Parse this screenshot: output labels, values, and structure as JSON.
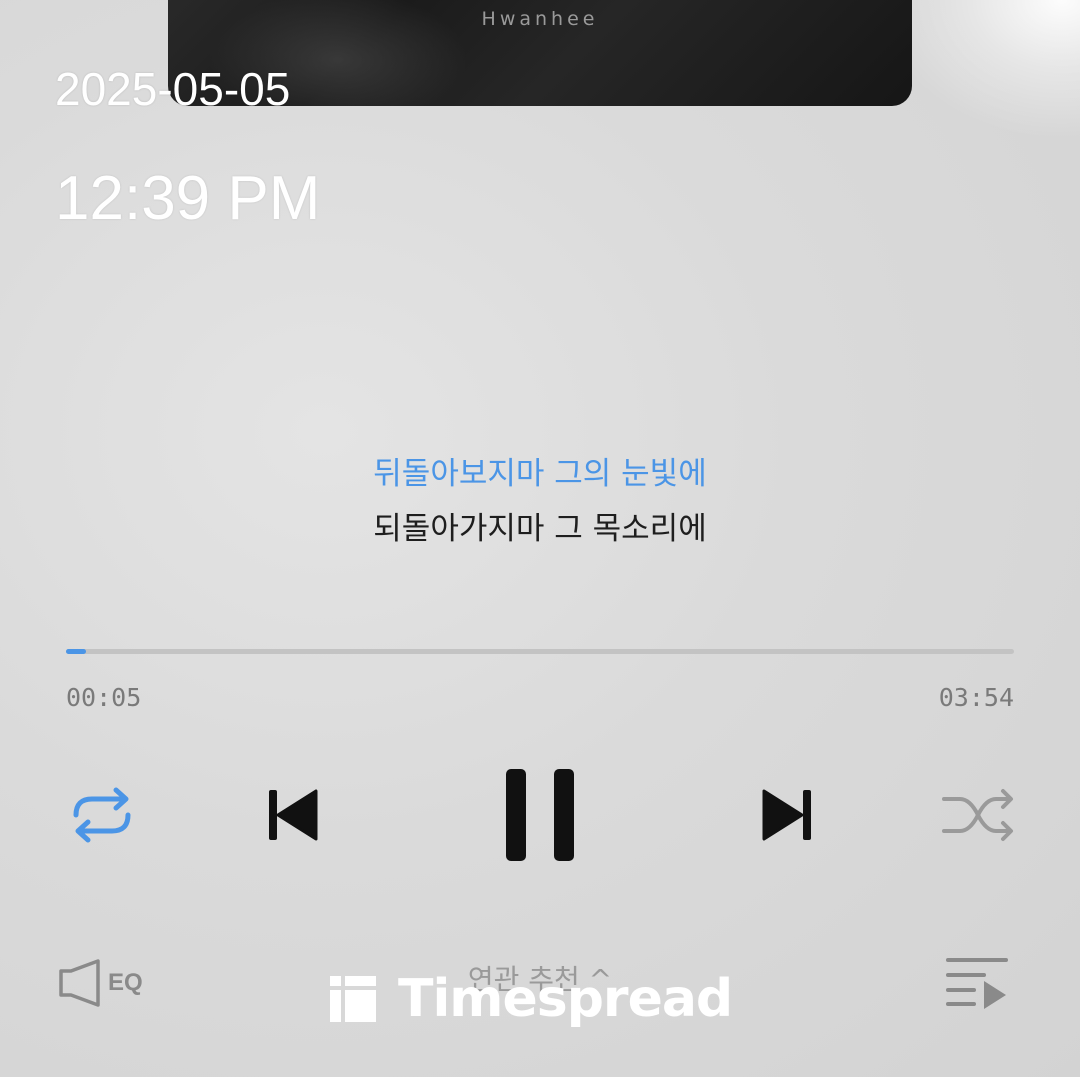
{
  "status": {
    "date": "2025-05-05",
    "time": "12:39 PM"
  },
  "album": {
    "artist": "Hwanhee"
  },
  "lyrics": {
    "current": "뒤돌아보지마 그의 눈빛에",
    "next": "되돌아가지마 그 목소리에"
  },
  "playback": {
    "elapsed": "00:05",
    "duration": "03:54",
    "progress_fraction": 0.021,
    "state": "playing"
  },
  "controls": {
    "repeat": {
      "icon": "repeat-icon",
      "active": true
    },
    "previous": {
      "icon": "skip-previous-icon"
    },
    "pause": {
      "icon": "pause-icon"
    },
    "next": {
      "icon": "skip-next-icon"
    },
    "shuffle": {
      "icon": "shuffle-icon",
      "active": false
    }
  },
  "bottom_bar": {
    "eq_label": "EQ",
    "recommend_label": "연관 추천 ^",
    "playlist_icon": "playlist-icon"
  },
  "watermark": {
    "text": "Timespread"
  },
  "colors": {
    "accent": "#4b95e6",
    "background": "#d8d8d8",
    "text_dark": "#1e1e1e",
    "text_muted": "#7a7a7a"
  }
}
